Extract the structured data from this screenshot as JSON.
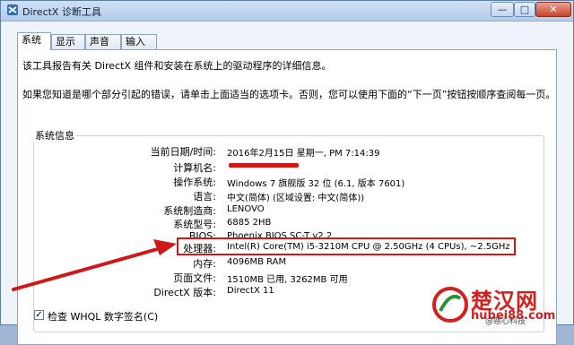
{
  "window": {
    "title": "DirectX 诊断工具",
    "controls": {
      "minimize": "—",
      "maximize": "□",
      "close": "✕"
    }
  },
  "tabs": [
    "系统",
    "显示",
    "声音",
    "输入"
  ],
  "intro": {
    "line1": "该工具报告有关 DirectX 组件和安装在系统上的驱动程序的详细信息。",
    "line2": "如果您知道是哪个部分引起的错误，请单击上面适当的选项卡。否则，您可以使用下面的“下一页”按钮按顺序查阅每一页。"
  },
  "sysinfo": {
    "title": "系统信息",
    "rows": [
      {
        "label": "当前日期/时间:",
        "value": "2016年2月15日 星期一, PM 7:14:39"
      },
      {
        "label": "计算机名:",
        "value": ""
      },
      {
        "label": "操作系统:",
        "value": "Windows 7 旗舰版 32 位 (6.1, 版本 7601)"
      },
      {
        "label": "语言:",
        "value": "中文(简体) (区域设置: 中文(简体))"
      },
      {
        "label": "系统制造商:",
        "value": "LENOVO"
      },
      {
        "label": "系统型号:",
        "value": "6885 2HB"
      },
      {
        "label": "BIOS:",
        "value": "Phoenix BIOS SC-T v2.2"
      },
      {
        "label": "处理器:",
        "value": "Intel(R) Core(TM) i5-3210M CPU @ 2.50GHz (4 CPUs), ~2.5GHz"
      },
      {
        "label": "内存:",
        "value": "4096MB RAM"
      },
      {
        "label": "页面文件:",
        "value": "1510MB 已用, 3262MB 可用"
      },
      {
        "label": "DirectX 版本:",
        "value": "DirectX 11"
      }
    ]
  },
  "whql": {
    "label": "检查 WHQL 数字签名(C)",
    "checked": "✓"
  },
  "watermark": {
    "name": "楚汉网",
    "url": "hubei88.com",
    "sub": "@惑心科技"
  },
  "colors": {
    "highlight": "#cc1a1a",
    "title_bar": "#b3cce9"
  }
}
